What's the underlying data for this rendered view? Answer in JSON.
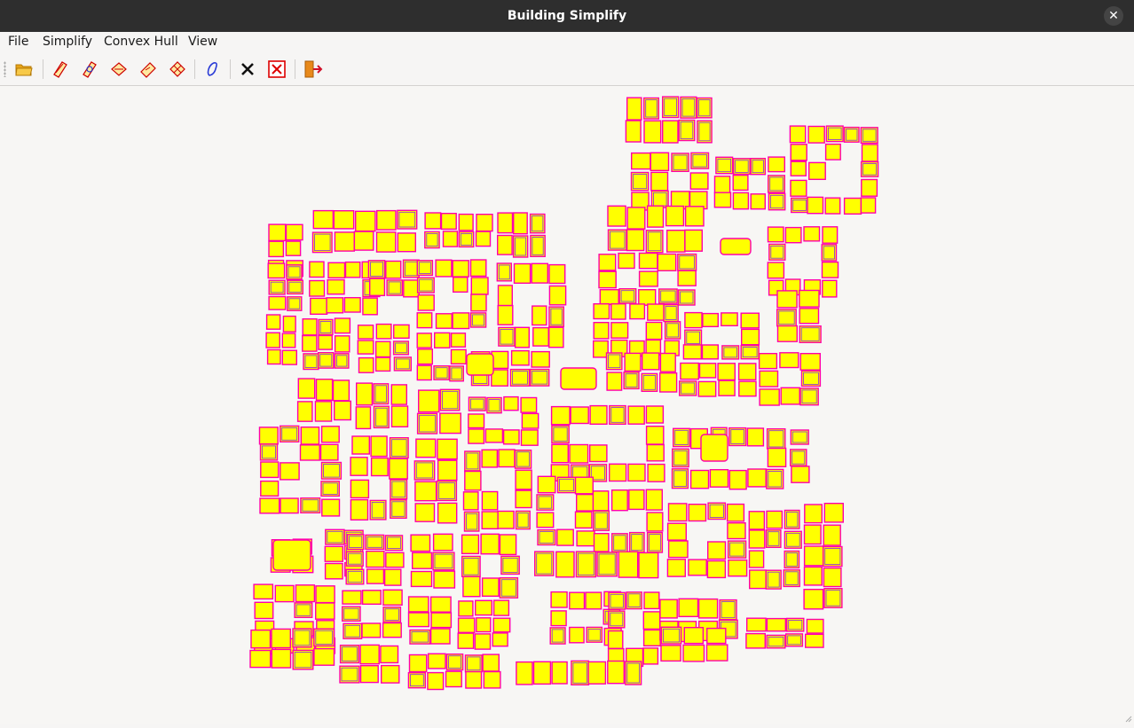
{
  "window": {
    "title": "Building Simplify",
    "close_glyph": "✕"
  },
  "menubar": {
    "file": "File",
    "simplify": "Simplify",
    "convex_hull": "Convex Hull",
    "view": "View"
  },
  "toolbar": {
    "buttons": [
      {
        "name": "open-file-icon"
      },
      {
        "name": "simplify-method-1-icon"
      },
      {
        "name": "simplify-method-2-icon"
      },
      {
        "name": "simplify-method-3-icon"
      },
      {
        "name": "simplify-method-4-icon"
      },
      {
        "name": "simplify-method-5-icon"
      },
      {
        "name": "convex-hull-icon"
      },
      {
        "name": "clear-icon"
      },
      {
        "name": "clear-all-icon"
      },
      {
        "name": "exit-icon"
      }
    ]
  },
  "map": {
    "fill_color": "#ffff00",
    "outline_color": "#ff00aa",
    "simplified_color": "#8a2be2"
  }
}
